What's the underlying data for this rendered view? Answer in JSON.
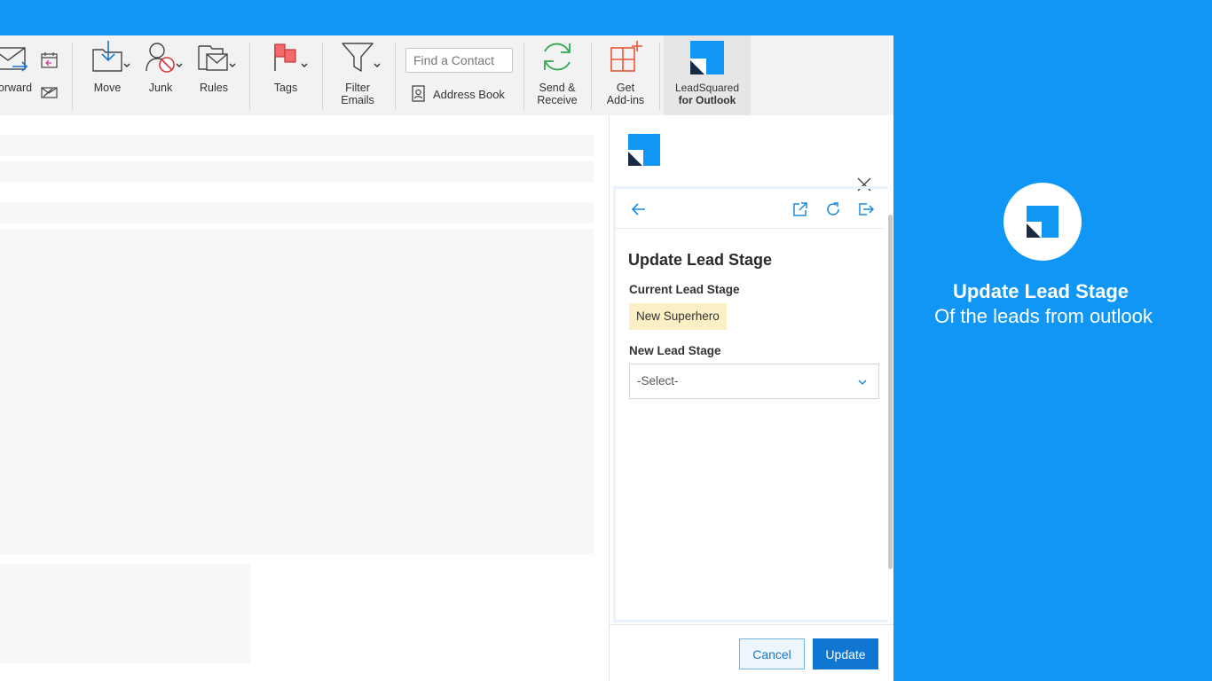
{
  "ribbon": {
    "forward_label": "orward",
    "move_label": "Move",
    "junk_label": "Junk",
    "rules_label": "Rules",
    "tags_label": "Tags",
    "filter_label_1": "Filter",
    "filter_label_2": "Emails",
    "find_contact_placeholder": "Find a Contact",
    "address_book_label": "Address Book",
    "send_receive_1": "Send &",
    "send_receive_2": "Receive",
    "get_addins_1": "Get",
    "get_addins_2": "Add-ins",
    "leadsquared_1": "LeadSquared",
    "leadsquared_2": "for Outlook"
  },
  "pane": {
    "form_title": "Update Lead Stage",
    "current_stage_label": "Current Lead Stage",
    "current_stage_value": "New Superhero",
    "new_stage_label": "New Lead Stage",
    "new_stage_selected": "-Select-",
    "cancel_label": "Cancel",
    "update_label": "Update"
  },
  "promo": {
    "title": "Update Lead Stage",
    "subtitle": "Of the leads from outlook"
  },
  "colors": {
    "background_blue": "#1097f5",
    "brand_blue": "#0f76d1",
    "badge_yellow": "#fcefc6"
  }
}
